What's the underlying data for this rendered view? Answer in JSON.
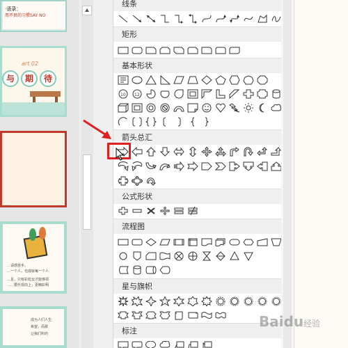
{
  "slides_panel": {
    "slide1": {
      "title": "而不良的习惯SAY NO",
      "badge": "·语录："
    },
    "slide2": {
      "part": "art 02",
      "chars": [
        "与",
        "期",
        "待"
      ]
    },
    "slide4": {
      "lines": [
        "…请感放手。",
        "…一个人，也成就每一个人",
        "…且，只有彩虹云才能够领",
        "……要乐观向上，更精彩明"
      ]
    },
    "slide5": {
      "lines": [
        "成为人们人生",
        "希望，而那",
        "让我们所的"
      ]
    }
  },
  "gallery": {
    "sections": [
      {
        "id": "lines",
        "title": "线条"
      },
      {
        "id": "rect",
        "title": "矩形"
      },
      {
        "id": "basic",
        "title": "基本形状"
      },
      {
        "id": "arrows",
        "title": "箭头总汇"
      },
      {
        "id": "formula",
        "title": "公式形状"
      },
      {
        "id": "flowchart",
        "title": "流程图"
      },
      {
        "id": "stars",
        "title": "星与旗帜"
      },
      {
        "id": "callouts",
        "title": "标注"
      }
    ]
  },
  "watermark": {
    "text": "Baidu",
    "sub": "经验"
  },
  "colors": {
    "highlight": "#e02020",
    "selected_slide_border": "#c0392b",
    "slide_accent": "#a7dccf"
  }
}
